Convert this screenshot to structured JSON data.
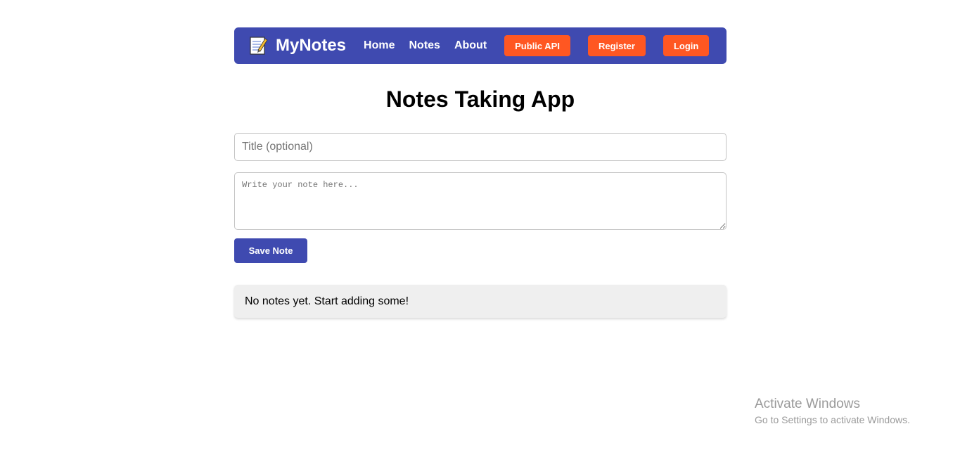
{
  "navbar": {
    "brand": "MyNotes",
    "brand_icon": "memo-icon",
    "links": {
      "home": "Home",
      "notes": "Notes",
      "about": "About"
    },
    "buttons": {
      "public_api": "Public API",
      "register": "Register",
      "login": "Login"
    },
    "colors": {
      "bar": "#3f4ab0",
      "button": "#ff5722"
    }
  },
  "main": {
    "heading": "Notes Taking App",
    "title_placeholder": "Title (optional)",
    "note_placeholder": "Write your note here...",
    "save_label": "Save Note",
    "empty_message": "No notes yet. Start adding some!"
  },
  "watermark": {
    "title": "Activate Windows",
    "subtitle": "Go to Settings to activate Windows."
  }
}
